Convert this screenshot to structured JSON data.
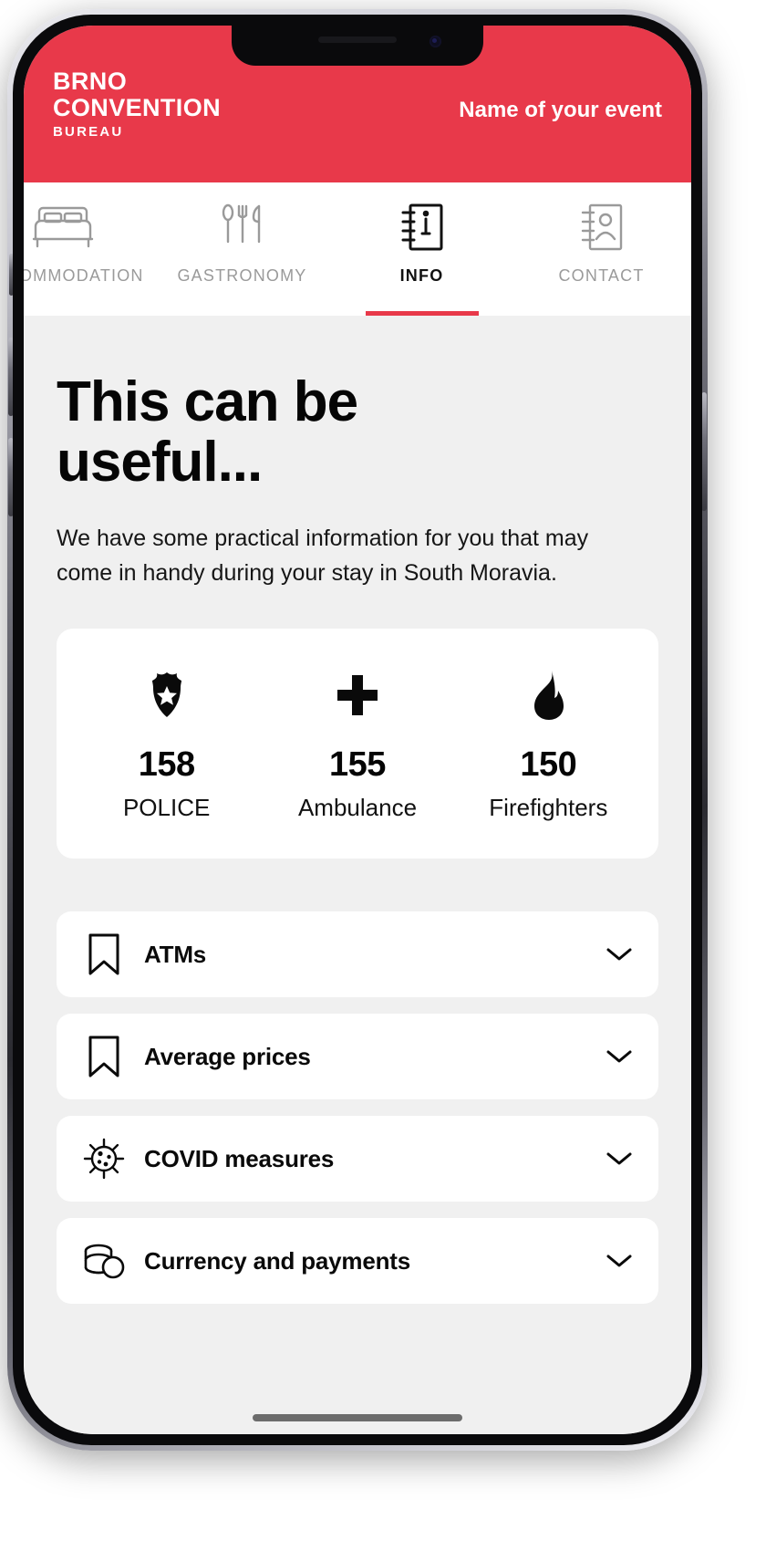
{
  "theme": {
    "brand_red": "#e8394a",
    "page_background": "#f0f0f0",
    "card_background": "#ffffff",
    "text_primary": "#050505",
    "nav_inactive": "#9a9a9a"
  },
  "header": {
    "logo_line1": "BRNO",
    "logo_line2": "CONVENTION",
    "logo_line3": "BUREAU",
    "event_name": "Name of your event"
  },
  "nav": {
    "tabs": [
      {
        "label": "ACCOMMODATION",
        "icon": "bed-icon",
        "active": false
      },
      {
        "label": "GASTRONOMY",
        "icon": "cutlery-icon",
        "active": false
      },
      {
        "label": "INFO",
        "icon": "info-notebook-icon",
        "active": true
      },
      {
        "label": "CONTACT",
        "icon": "contact-notebook-icon",
        "active": false
      }
    ]
  },
  "main": {
    "title": "This can be useful...",
    "title_line1": "This can be",
    "title_line2": "useful...",
    "intro": "We have some practical information for you that may come in handy during your stay in South Moravia.",
    "emergency_numbers": [
      {
        "number": "158",
        "label": "POLICE",
        "icon": "police-badge-icon"
      },
      {
        "number": "155",
        "label": "Ambulance",
        "icon": "medical-cross-icon"
      },
      {
        "number": "150",
        "label": "Firefighters",
        "icon": "flame-icon"
      }
    ],
    "accordion_items": [
      {
        "label": "ATMs",
        "icon": "bookmark-icon",
        "chevron": "chevron-down-icon",
        "expanded": false
      },
      {
        "label": "Average prices",
        "icon": "bookmark-icon",
        "chevron": "chevron-down-icon",
        "expanded": false
      },
      {
        "label": "COVID measures",
        "icon": "virus-icon",
        "chevron": "chevron-down-icon",
        "expanded": false
      },
      {
        "label": "Currency and payments",
        "icon": "coins-icon",
        "chevron": "chevron-down-icon",
        "expanded": false
      }
    ]
  }
}
